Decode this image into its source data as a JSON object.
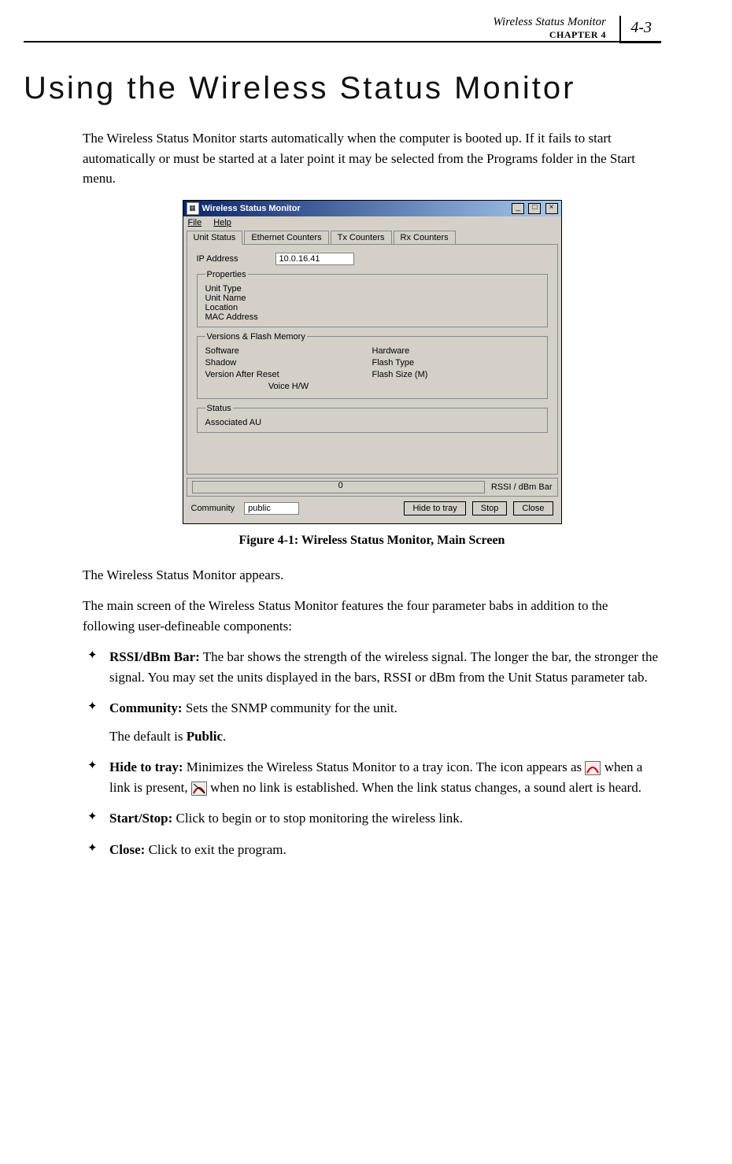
{
  "header": {
    "running_title": "Wireless Status Monitor",
    "chapter_label": "CHAPTER 4",
    "page_number": "4-3"
  },
  "title": "Using the Wireless Status Monitor",
  "intro": "The Wireless Status Monitor starts automatically when the computer is booted up. If it fails to start automatically or must be started at a later point it may be selected from the Programs folder in the Start menu.",
  "screenshot": {
    "window_title": "Wireless Status Monitor",
    "menu": {
      "file": "File",
      "help": "Help"
    },
    "tabs": {
      "unit_status": "Unit Status",
      "ethernet_counters": "Ethernet Counters",
      "tx_counters": "Tx Counters",
      "rx_counters": "Rx Counters"
    },
    "ip_label": "IP Address",
    "ip_value": "10.0.16.41",
    "groups": {
      "properties": {
        "legend": "Properties",
        "unit_type": "Unit Type",
        "unit_name": "Unit Name",
        "location": "Location",
        "mac": "MAC Address"
      },
      "versions": {
        "legend": "Versions & Flash Memory",
        "software": "Software",
        "shadow": "Shadow",
        "version_after_reset": "Version After Reset",
        "voice_hw": "Voice H/W",
        "hardware": "Hardware",
        "flash_type": "Flash Type",
        "flash_size": "Flash Size (M)"
      },
      "status": {
        "legend": "Status",
        "associated_au": "Associated AU"
      }
    },
    "bar_zero": "0",
    "bar_label": "RSSI / dBm Bar",
    "community_label": "Community",
    "community_value": "public",
    "buttons": {
      "hide": "Hide to tray",
      "stop": "Stop",
      "close": "Close"
    }
  },
  "figure_caption": "Figure 4-1: Wireless Status Monitor, Main Screen",
  "after_fig_p1": "The Wireless Status Monitor appears.",
  "after_fig_p2": "The main screen of the Wireless Status Monitor features the four parameter babs in addition to the following user-defineable components:",
  "bullets": {
    "rssi": {
      "label": "RSSI/dBm Bar:",
      "text": " The bar shows the strength of the wireless signal. The longer the bar, the stronger the signal. You may set the units displayed in the bars, RSSI or dBm from the Unit Status parameter tab."
    },
    "community": {
      "label": "Community:",
      "text": " Sets the SNMP community for the unit.",
      "sub_prefix": "The default is ",
      "sub_bold": "Public",
      "sub_suffix": "."
    },
    "hide": {
      "label": "Hide to tray:",
      "text_a": " Minimizes the Wireless Status Monitor to a tray icon. The icon appears as ",
      "text_b": " when a link is present, ",
      "text_c": " when no link is established. When the link status changes, a sound alert is heard."
    },
    "startstop": {
      "label": "Start/Stop:",
      "text": " Click to begin or to stop monitoring the wireless link."
    },
    "close": {
      "label": "Close:",
      "text": " Click to exit the program."
    }
  }
}
